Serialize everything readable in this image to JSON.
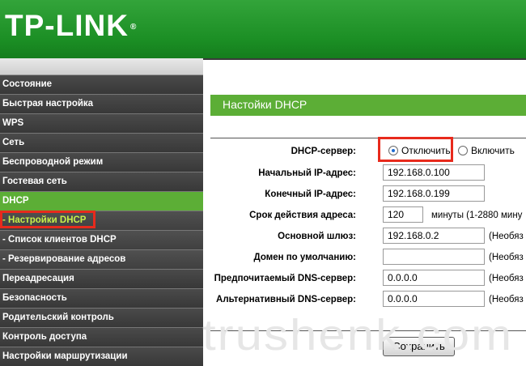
{
  "brand": {
    "logo_text": "TP-LINK",
    "registered": "®",
    "header_color": "#1e9227"
  },
  "sidebar": {
    "items": [
      {
        "label": "Состояние"
      },
      {
        "label": "Быстрая настройка"
      },
      {
        "label": "WPS"
      },
      {
        "label": "Сеть"
      },
      {
        "label": "Беспроводной режим"
      },
      {
        "label": "Гостевая сеть"
      },
      {
        "label": "DHCP"
      },
      {
        "label": "- Настройки DHCP"
      },
      {
        "label": "- Список клиентов DHCP"
      },
      {
        "label": "- Резервирование адресов"
      },
      {
        "label": "Переадресация"
      },
      {
        "label": "Безопасность"
      },
      {
        "label": "Родительский контроль"
      },
      {
        "label": "Контроль доступа"
      },
      {
        "label": "Настройки маршрутизации"
      }
    ],
    "active_color": "#5cae36"
  },
  "main": {
    "section_title": "Настойки DHCP",
    "dhcp_server": {
      "label": "DHCP-сервер:",
      "option_off": "Отключить",
      "option_on": "Включить",
      "selected": "Отключить"
    },
    "start_ip": {
      "label": "Начальный IP-адрес:",
      "value": "192.168.0.100"
    },
    "end_ip": {
      "label": "Конечный IP-адрес:",
      "value": "192.168.0.199"
    },
    "lease": {
      "label": "Срок действия адреса:",
      "value": "120",
      "note": "минуты (1-2880 мину"
    },
    "gateway": {
      "label": "Основной шлюз:",
      "value": "192.168.0.2",
      "note": "(Необяз"
    },
    "domain": {
      "label": "Домен по умолчанию:",
      "value": "",
      "note": "(Необяз"
    },
    "dns_primary": {
      "label": "Предпочитаемый DNS-сервер:",
      "value": "0.0.0.0",
      "note": "(Необяз"
    },
    "dns_secondary": {
      "label": "Альтернативный DNS-сервер:",
      "value": "0.0.0.0",
      "note": "(Необяз"
    },
    "save_label": "Сохранить"
  },
  "watermark": "trushenk.com",
  "highlight_color": "#e82a1c"
}
